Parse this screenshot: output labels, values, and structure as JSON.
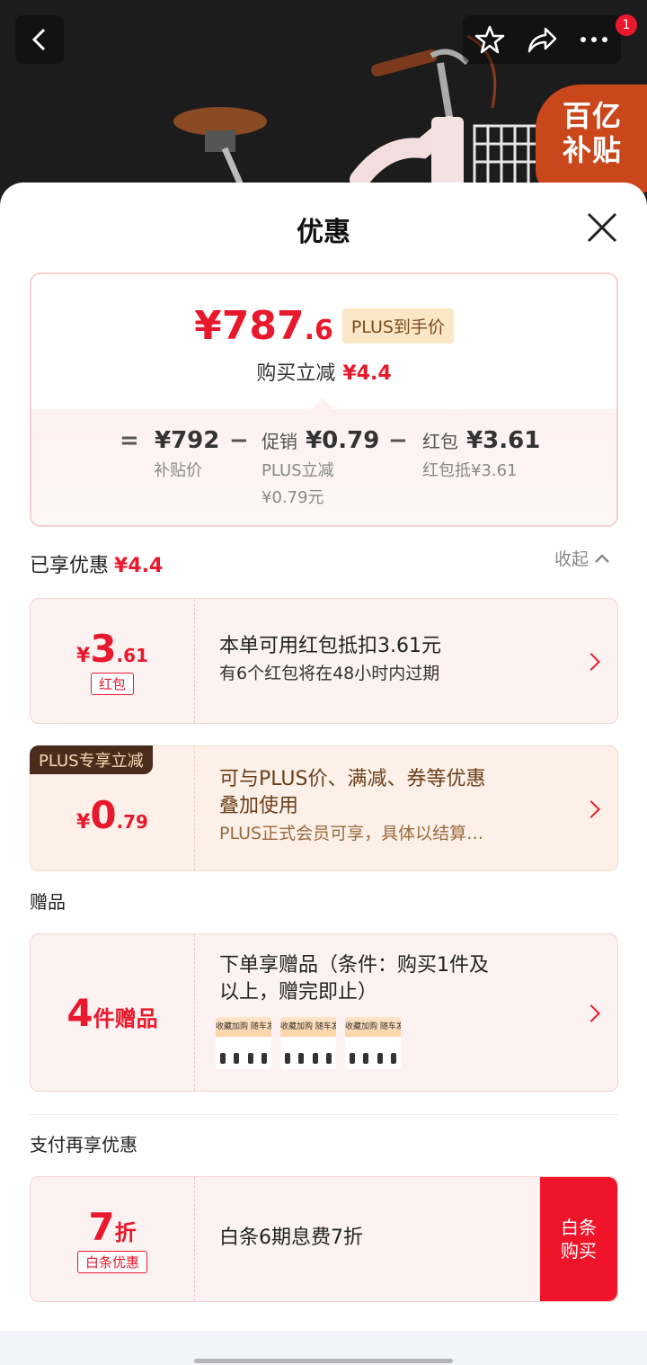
{
  "header": {
    "badge_count": "1",
    "subsidy_label_line1": "百亿",
    "subsidy_label_line2": "补贴"
  },
  "sheet": {
    "title": "优惠"
  },
  "price_card": {
    "currency": "¥",
    "price_int": "787",
    "price_dec": ".6",
    "plus_tag": "PLUS到手价",
    "save_label": "购买立减",
    "save_amount": "¥4.4",
    "eq": "=",
    "minus": "−",
    "base_value": "¥792",
    "base_label": "补贴价",
    "promo_prefix": "促销",
    "promo_value": "¥0.79",
    "promo_label_1": "PLUS立减",
    "promo_label_2": "¥0.79元",
    "hb_prefix": "红包",
    "hb_value": "¥3.61",
    "hb_label": "红包抵¥3.61"
  },
  "enjoyed": {
    "label": "已享优惠",
    "amount": "¥4.4",
    "collapse_label": "收起"
  },
  "offers": [
    {
      "currency": "¥",
      "int": "3",
      "dec": ".61",
      "tag": "红包",
      "line1": "本单可用红包抵扣3.61元",
      "line2": "有6个红包将在48小时内过期"
    },
    {
      "corner": "PLUS专享立减",
      "currency": "¥",
      "int": "0",
      "dec": ".79",
      "line1": "可与PLUS价、满减、券等优惠",
      "line2": "叠加使用",
      "line3": "PLUS正式会员可享，具体以结算…"
    }
  ],
  "gift": {
    "section": "赠品",
    "count": "4",
    "count_suffix": "件赠品",
    "line1": "下单享赠品（条件：购买1件及",
    "line2": "以上，赠完即止）",
    "thumb_text": "收藏加购 随车发出"
  },
  "pay": {
    "section": "支付再享优惠",
    "discount": "7",
    "discount_suffix": "折",
    "tag": "白条优惠",
    "text": "白条6期息费7折",
    "button_line1": "白条",
    "button_line2": "购买"
  },
  "colors": {
    "accent_red": "#e8192c",
    "plus_gold": "#fbe7c6"
  }
}
